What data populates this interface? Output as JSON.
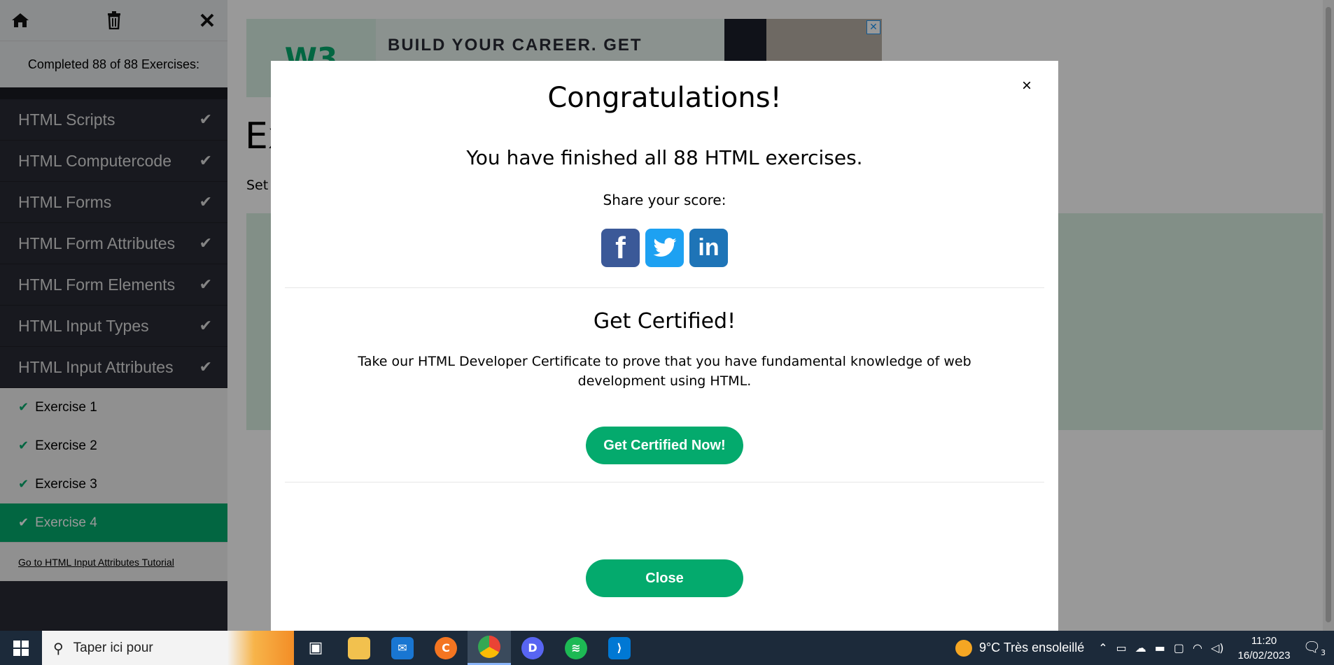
{
  "sidebar": {
    "home_icon": "home-icon",
    "trash_icon": "trash-icon",
    "close_icon": "close-icon",
    "progress": "Completed 88 of 88 Exercises:",
    "categories": [
      {
        "label": "HTML Scripts"
      },
      {
        "label": "HTML Computercode"
      },
      {
        "label": "HTML Forms"
      },
      {
        "label": "HTML Form Attributes"
      },
      {
        "label": "HTML Form Elements"
      },
      {
        "label": "HTML Input Types"
      },
      {
        "label": "HTML Input Attributes"
      }
    ],
    "exercises": [
      {
        "label": "Exercise 1"
      },
      {
        "label": "Exercise 2"
      },
      {
        "label": "Exercise 3"
      },
      {
        "label": "Exercise 4"
      }
    ],
    "tutorial_link": "Go to HTML Input Attributes Tutorial"
  },
  "main": {
    "ad_text": "BUILD YOUR CAREER. GET",
    "ad_logo": "W3",
    "title_partial": "Ex",
    "subtitle_partial": "Set"
  },
  "modal": {
    "title": "Congratulations!",
    "finished": "You have finished all 88 HTML exercises.",
    "share": "Share your score:",
    "social": [
      "facebook",
      "twitter",
      "linkedin"
    ],
    "cert_title": "Get Certified!",
    "cert_text": "Take our HTML Developer Certificate to prove that you have fundamental knowledge of web development using HTML.",
    "cert_button": "Get Certified Now!",
    "close_button": "Close",
    "close_x": "×"
  },
  "taskbar": {
    "search_placeholder": "Taper ici pour",
    "weather": "9°C  Très ensoleillé",
    "time": "11:20",
    "date": "16/02/2023",
    "notifications": "3"
  },
  "colors": {
    "accent": "#04AA6D",
    "sidebar_bg": "#282A35"
  }
}
